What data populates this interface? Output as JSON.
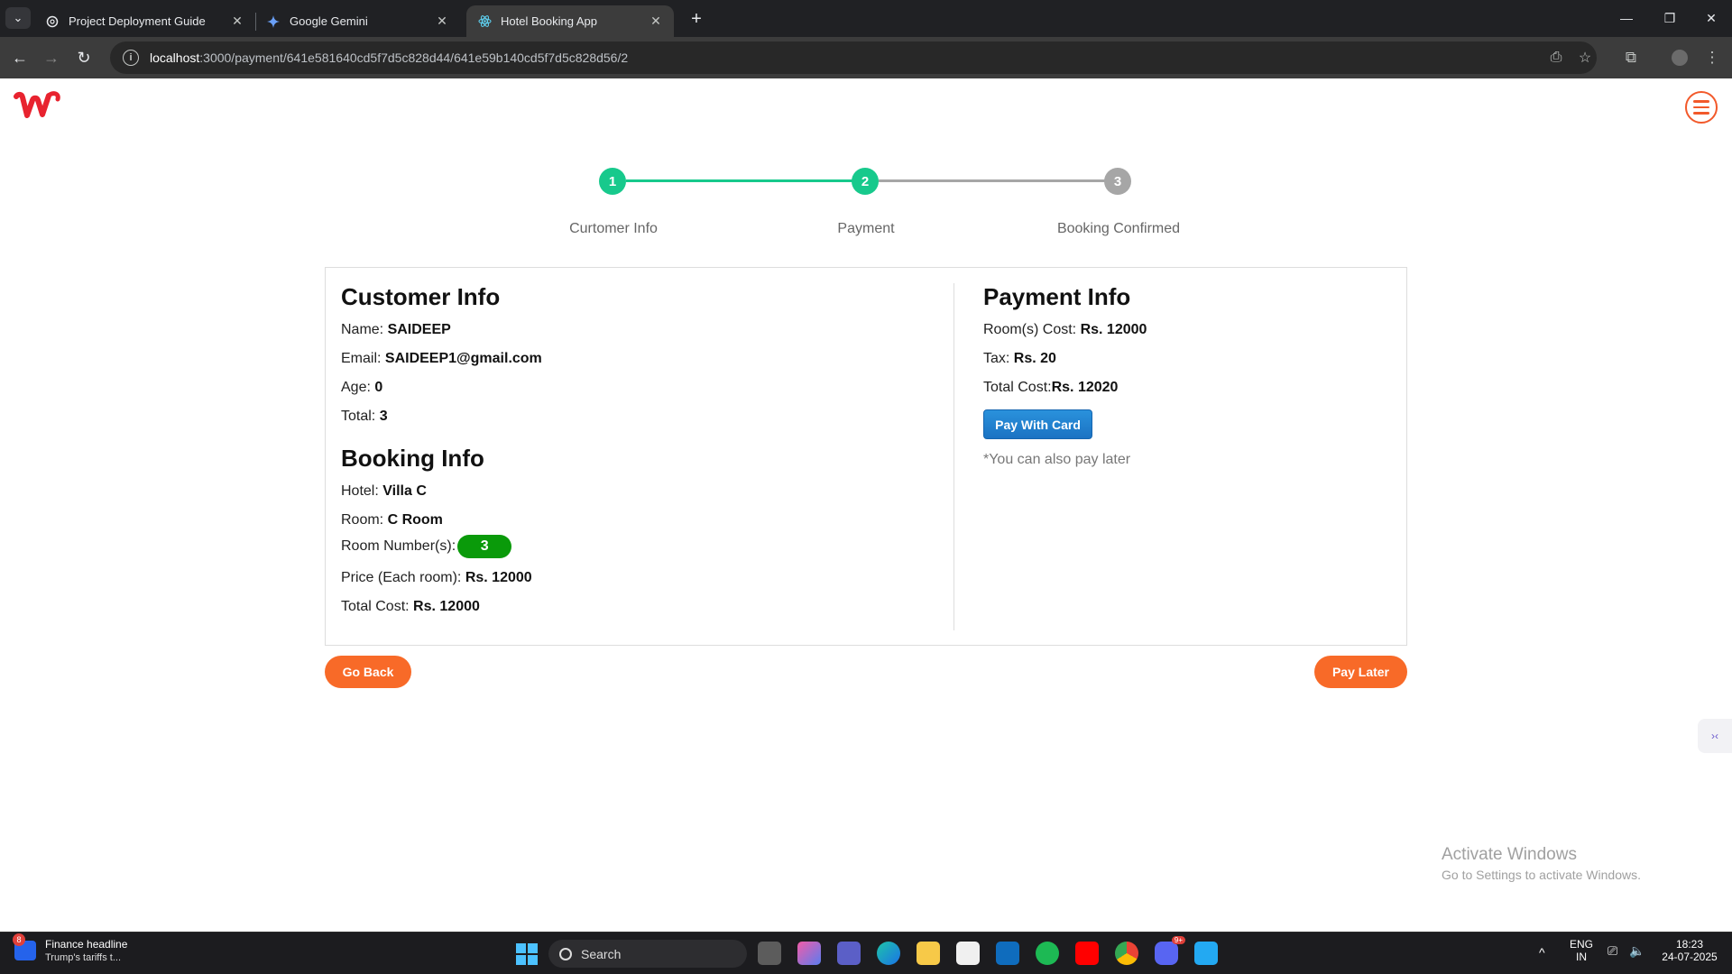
{
  "browser": {
    "tabs": [
      {
        "title": "Project Deployment Guide",
        "icon": "openai-icon",
        "active": false
      },
      {
        "title": "Google Gemini",
        "icon": "gemini-icon",
        "active": false
      },
      {
        "title": "Hotel Booking App",
        "icon": "react-icon",
        "active": true
      }
    ],
    "url_host": "localhost",
    "url_rest": ":3000/payment/641e581640cd5f7d5c828d44/641e59b140cd5f7d5c828d56/2"
  },
  "stepper": {
    "steps": [
      {
        "number": "1",
        "label": "Curtomer Info",
        "state": "done"
      },
      {
        "number": "2",
        "label": "Payment",
        "state": "current"
      },
      {
        "number": "3",
        "label": "Booking Confirmed",
        "state": "pending"
      }
    ],
    "colors": {
      "active": "#17c98c",
      "inactive": "#a6a6a6"
    }
  },
  "customer_info": {
    "heading": "Customer Info",
    "name_label": "Name:",
    "name_value": "SAIDEEP",
    "email_label": "Email:",
    "email_value": "SAIDEEP1@gmail.com",
    "age_label": "Age:",
    "age_value": "0",
    "total_label": "Total:",
    "total_value": "3"
  },
  "booking_info": {
    "heading": "Booking Info",
    "hotel_label": "Hotel:",
    "hotel_value": "Villa C",
    "room_label": "Room:",
    "room_value": "C Room",
    "room_numbers_label": "Room Number(s):",
    "room_numbers_value": "3",
    "price_label": "Price (Each room):",
    "price_value": "Rs. 12000",
    "total_cost_label": "Total Cost:",
    "total_cost_value": "Rs. 12000"
  },
  "payment_info": {
    "heading": "Payment Info",
    "rooms_cost_label": "Room(s) Cost:",
    "rooms_cost_value": "Rs. 12000",
    "tax_label": "Tax:",
    "tax_value": "Rs. 20",
    "total_cost_label": "Total Cost:",
    "total_cost_value": "Rs. 12020",
    "pay_card_label": "Pay With Card",
    "pay_later_note": "*You can also pay later"
  },
  "actions": {
    "go_back": "Go Back",
    "pay_later": "Pay Later"
  },
  "watermark": {
    "line1": "Activate Windows",
    "line2": "Go to Settings to activate Windows."
  },
  "taskbar": {
    "news_badge": "8",
    "news_title": "Finance headline",
    "news_sub": "Trump's tariffs t...",
    "search_placeholder": "Search",
    "lang1": "ENG",
    "lang2": "IN",
    "time": "18:23",
    "date": "24-07-2025",
    "discord_badge": "9+"
  }
}
